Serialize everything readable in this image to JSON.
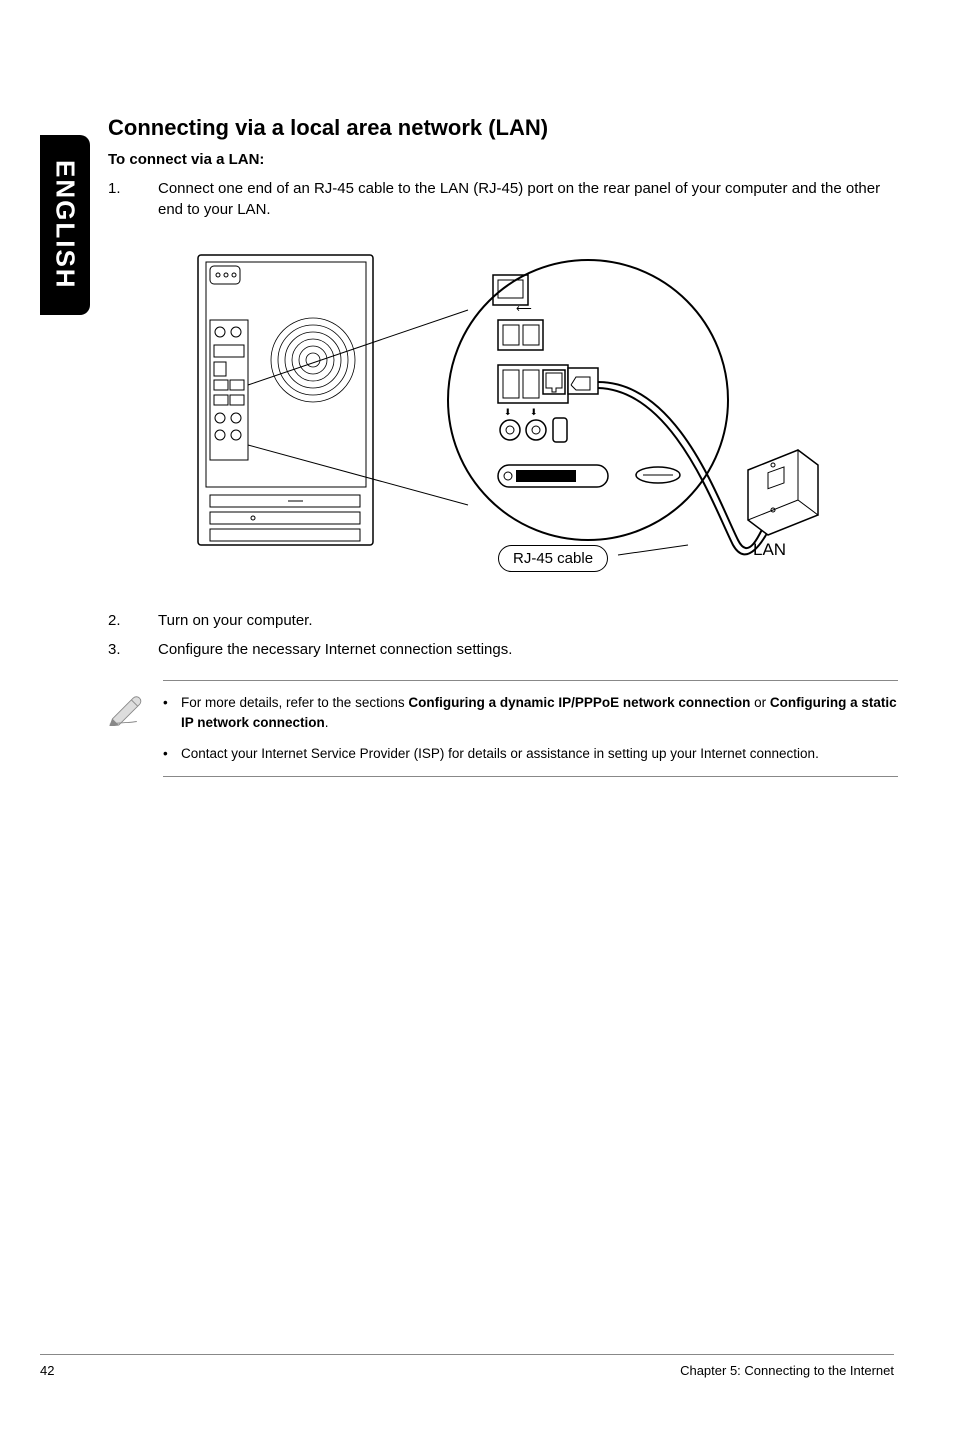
{
  "sideTab": "ENGLISH",
  "sectionTitle": "Connecting via a local area network (LAN)",
  "subtitle": "To connect via a LAN:",
  "steps": [
    {
      "num": "1.",
      "text": "Connect one end of an RJ-45 cable to the LAN (RJ-45) port on the rear panel of your computer and the other end to your LAN."
    },
    {
      "num": "2.",
      "text": "Turn on your computer."
    },
    {
      "num": "3.",
      "text": "Configure the necessary Internet connection settings."
    }
  ],
  "diagram": {
    "cableLabel": "RJ-45 cable",
    "lanLabel": "LAN"
  },
  "notes": [
    {
      "prefix": "For more details, refer to the sections ",
      "bold1": "Configuring a dynamic IP/PPPoE network connection",
      "mid": " or ",
      "bold2": "Configuring a static IP network connection",
      "suffix": "."
    },
    {
      "text": "Contact your Internet Service Provider (ISP) for details or assistance in setting up your Internet connection."
    }
  ],
  "footer": {
    "pageNum": "42",
    "chapter": "Chapter 5: Connecting to the Internet"
  }
}
